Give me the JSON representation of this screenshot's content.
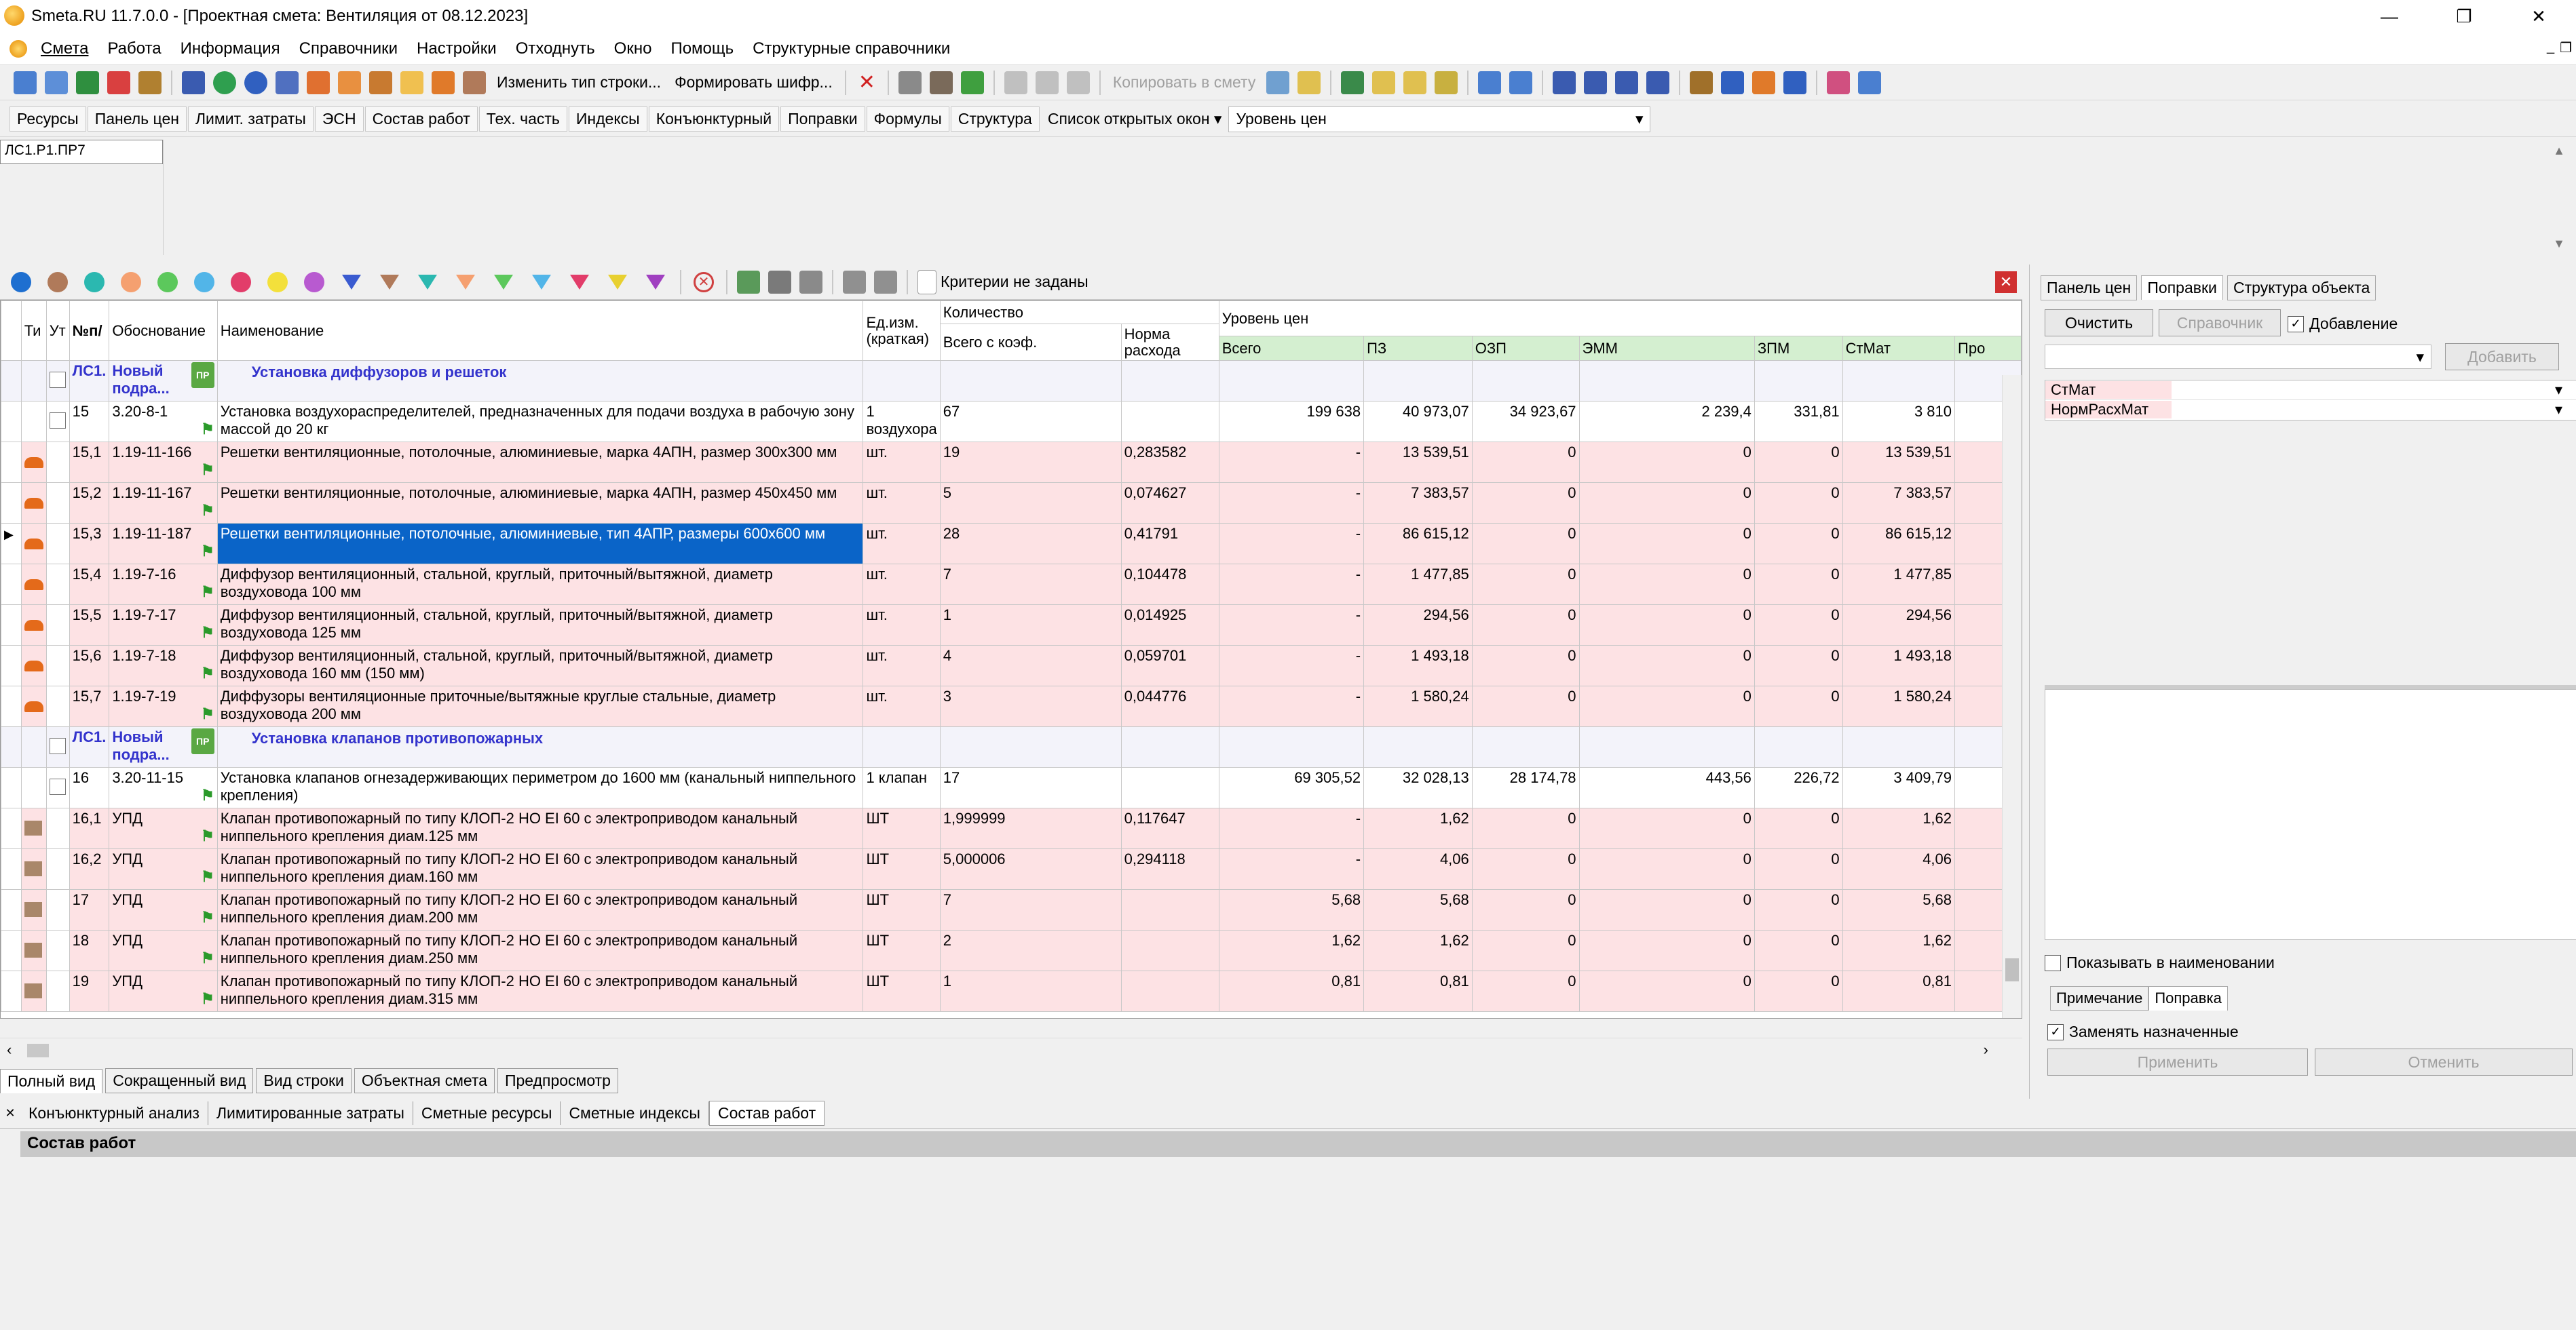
{
  "window": {
    "title": "Smeta.RU  11.7.0.0  - [Проектная смета: Вентиляция от 08.12.2023]"
  },
  "menu": [
    "Смета",
    "Работа",
    "Информация",
    "Справочники",
    "Настройки",
    "Отходнуть",
    "Окно",
    "Помощь",
    "Структурные справочники"
  ],
  "toolbar1": {
    "change_row_type": "Изменить тип строки...",
    "form_code": "Формировать шифр...",
    "copy_to_smeta": "Копировать в смету"
  },
  "toolbar2": {
    "tabs": [
      "Ресурсы",
      "Панель цен",
      "Лимит. затраты",
      "ЭСН",
      "Состав работ",
      "Тех. часть",
      "Индексы",
      "Конъюнктурный",
      "Поправки",
      "Формулы",
      "Структура"
    ],
    "open_windows": "Список открытых окон",
    "price_level": "Уровень цен"
  },
  "address": "ЛС1.Р1.ПР7",
  "filter": {
    "criteria": "Критерии не заданы",
    "colors": [
      "#1e6fd0",
      "#b07a5a",
      "#2bb8b0",
      "#f5a070",
      "#5cc85c",
      "#52b5e8",
      "#e23d6a",
      "#f3e03b",
      "#b85ad0"
    ],
    "funnel_colors": [
      "#3a5bd0",
      "#b07a5a",
      "#2bb8b0",
      "#f5a070",
      "#5cc85c",
      "#52b5e8",
      "#e23d6a",
      "#e8d030",
      "#a040c0"
    ]
  },
  "grid": {
    "headers": {
      "type": "Ти",
      "ut": "Ут",
      "npp": "№п/",
      "basis": "Обоснование",
      "name": "Наименование",
      "unit": "Ед.изм. (краткая)",
      "qty": "Количество",
      "qty_total": "Всего с коэф.",
      "norm": "Норма расхода",
      "price_level": "Уровень цен",
      "total": "Всего",
      "pz": "ПЗ",
      "ozp": "ОЗП",
      "emm": "ЭММ",
      "zpm": "ЗПМ",
      "stmat": "СтМат",
      "pro": "Про"
    },
    "rows": [
      {
        "kind": "h",
        "npp": "ЛС1.",
        "basis": "Новый подра...",
        "name": "Установка диффузоров и решеток"
      },
      {
        "kind": "w",
        "npp": "15",
        "basis": "3.20-8-1",
        "name": "Установка воздухораспределителей, предназначенных для подачи воздуха в рабочую зону массой до 20 кг",
        "unit": "1 воздухора",
        "qty": "67",
        "norm": "",
        "total": "199 638",
        "pz": "40 973,07",
        "ozp": "34 923,67",
        "emm": "2 239,4",
        "zpm": "331,81",
        "stmat": "3 810"
      },
      {
        "kind": "r",
        "t": "m",
        "npp": "15,1",
        "basis": "1.19-11-166",
        "name": "Решетки вентиляционные, потолочные, алюминиевые, марка 4АПН, размер 300х300 мм",
        "unit": "шт.",
        "qty": "19",
        "norm": "0,283582",
        "total": "-",
        "pz": "13 539,51",
        "ozp": "0",
        "emm": "0",
        "zpm": "0",
        "stmat": "13 539,51"
      },
      {
        "kind": "r",
        "t": "m",
        "npp": "15,2",
        "basis": "1.19-11-167",
        "name": "Решетки вентиляционные, потолочные, алюминиевые, марка 4АПН, размер 450х450 мм",
        "unit": "шт.",
        "qty": "5",
        "norm": "0,074627",
        "total": "-",
        "pz": "7 383,57",
        "ozp": "0",
        "emm": "0",
        "zpm": "0",
        "stmat": "7 383,57"
      },
      {
        "kind": "r",
        "t": "m",
        "sel": true,
        "npp": "15,3",
        "basis": "1.19-11-187",
        "name": "Решетки вентиляционные, потолочные, алюминиевые, тип 4АПР, размеры 600х600 мм",
        "unit": "шт.",
        "qty": "28",
        "norm": "0,41791",
        "total": "-",
        "pz": "86 615,12",
        "ozp": "0",
        "emm": "0",
        "zpm": "0",
        "stmat": "86 615,12"
      },
      {
        "kind": "r",
        "t": "m",
        "npp": "15,4",
        "basis": "1.19-7-16",
        "name": "Диффузор вентиляционный, стальной, круглый, приточный/вытяжной, диаметр воздуховода 100 мм",
        "unit": "шт.",
        "qty": "7",
        "norm": "0,104478",
        "total": "-",
        "pz": "1 477,85",
        "ozp": "0",
        "emm": "0",
        "zpm": "0",
        "stmat": "1 477,85"
      },
      {
        "kind": "r",
        "t": "m",
        "npp": "15,5",
        "basis": "1.19-7-17",
        "name": "Диффузор вентиляционный, стальной, круглый, приточный/вытяжной, диаметр воздуховода 125 мм",
        "unit": "шт.",
        "qty": "1",
        "norm": "0,014925",
        "total": "-",
        "pz": "294,56",
        "ozp": "0",
        "emm": "0",
        "zpm": "0",
        "stmat": "294,56"
      },
      {
        "kind": "r",
        "t": "m",
        "npp": "15,6",
        "basis": "1.19-7-18",
        "name": "Диффузор вентиляционный, стальной, круглый, приточный/вытяжной, диаметр воздуховода 160 мм (150 мм)",
        "unit": "шт.",
        "qty": "4",
        "norm": "0,059701",
        "total": "-",
        "pz": "1 493,18",
        "ozp": "0",
        "emm": "0",
        "zpm": "0",
        "stmat": "1 493,18"
      },
      {
        "kind": "r",
        "t": "m",
        "npp": "15,7",
        "basis": "1.19-7-19",
        "name": "Диффузоры вентиляционные приточные/вытяжные круглые стальные, диаметр воздуховода 200 мм",
        "unit": "шт.",
        "qty": "3",
        "norm": "0,044776",
        "total": "-",
        "pz": "1 580,24",
        "ozp": "0",
        "emm": "0",
        "zpm": "0",
        "stmat": "1 580,24"
      },
      {
        "kind": "h",
        "npp": "ЛС1.",
        "basis": "Новый подра...",
        "name": "Установка клапанов противопожарных"
      },
      {
        "kind": "w",
        "npp": "16",
        "basis": "3.20-11-15",
        "name": "Установка клапанов огнезадерживающих периметром до 1600 мм (канальный ниппельного крепления)",
        "unit": "1 клапан",
        "qty": "17",
        "norm": "",
        "total": "69 305,52",
        "pz": "32 028,13",
        "ozp": "28 174,78",
        "emm": "443,56",
        "zpm": "226,72",
        "stmat": "3 409,79"
      },
      {
        "kind": "r",
        "t": "e",
        "npp": "16,1",
        "basis": "УПД",
        "name": "Клапан противопожарный по типу КЛОП-2 НО EI 60 с электроприводом канальный ниппельного крепления  диам.125 мм",
        "unit": "ШТ",
        "qty": "1,999999",
        "norm": "0,117647",
        "total": "-",
        "pz": "1,62",
        "ozp": "0",
        "emm": "0",
        "zpm": "0",
        "stmat": "1,62"
      },
      {
        "kind": "r",
        "t": "e",
        "npp": "16,2",
        "basis": "УПД",
        "name": "Клапан противопожарный по типу КЛОП-2 НО EI 60 с электроприводом канальный ниппельного крепления  диам.160 мм",
        "unit": "ШТ",
        "qty": "5,000006",
        "norm": "0,294118",
        "total": "-",
        "pz": "4,06",
        "ozp": "0",
        "emm": "0",
        "zpm": "0",
        "stmat": "4,06"
      },
      {
        "kind": "r",
        "t": "e",
        "npp": "17",
        "basis": "УПД",
        "name": "Клапан противопожарный по типу КЛОП-2 НО EI 60 с электроприводом канальный ниппельного крепления  диам.200 мм",
        "unit": "ШТ",
        "qty": "7",
        "norm": "",
        "total": "5,68",
        "pz": "5,68",
        "ozp": "0",
        "emm": "0",
        "zpm": "0",
        "stmat": "5,68"
      },
      {
        "kind": "r",
        "t": "e",
        "npp": "18",
        "basis": "УПД",
        "name": "Клапан противопожарный по типу КЛОП-2 НО EI 60 с электроприводом канальный ниппельного крепления  диам.250 мм",
        "unit": "ШТ",
        "qty": "2",
        "norm": "",
        "total": "1,62",
        "pz": "1,62",
        "ozp": "0",
        "emm": "0",
        "zpm": "0",
        "stmat": "1,62"
      },
      {
        "kind": "r",
        "t": "e",
        "npp": "19",
        "basis": "УПД",
        "name": "Клапан противопожарный по типу КЛОП-2 НО EI 60 с электроприводом канальный ниппельного крепления  диам.315 мм",
        "unit": "ШТ",
        "qty": "1",
        "norm": "",
        "total": "0,81",
        "pz": "0,81",
        "ozp": "0",
        "emm": "0",
        "zpm": "0",
        "stmat": "0,81"
      }
    ]
  },
  "view_tabs": [
    "Полный вид",
    "Сокращенный вид",
    "Вид строки",
    "Объектная смета",
    "Предпросмотр"
  ],
  "lower_tabs": [
    "Конъюнктурный анализ",
    "Лимитированные затраты",
    "Сметные ресурсы",
    "Сметные индексы",
    "Состав работ"
  ],
  "sostav_title": "Состав работ",
  "right_panel": {
    "tabs": [
      "Панель цен",
      "Поправки",
      "Структура объекта"
    ],
    "clear": "Очистить",
    "reference": "Справочник",
    "addition": "Добавление",
    "add": "Добавить",
    "fields": [
      "СтМат",
      "НормРасхМат"
    ],
    "show_in_name": "Показывать в наименовании",
    "sub_tabs": [
      "Примечание",
      "Поправка"
    ],
    "replace_assigned": "Заменять назначенные",
    "apply": "Применить",
    "cancel": "Отменить"
  }
}
